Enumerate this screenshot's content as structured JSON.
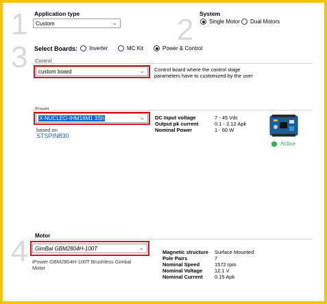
{
  "step1": {
    "number": "1",
    "title": "Application type",
    "select_value": "Custom"
  },
  "step2": {
    "number": "2",
    "title": "System",
    "options": [
      {
        "label": "Single Motor",
        "selected": true
      },
      {
        "label": "Dual Motors",
        "selected": false
      }
    ]
  },
  "step3": {
    "number": "3",
    "title": "Select Boards:",
    "options": [
      {
        "label": "Inverter",
        "selected": false
      },
      {
        "label": "MC Kit",
        "selected": false
      },
      {
        "label": "Power & Control",
        "selected": true
      }
    ]
  },
  "control": {
    "group_label": "Control",
    "select_value": "custom board",
    "description": "Control board where the control stage parameters have to customized by the user"
  },
  "power": {
    "group_label": "Power",
    "select_value": "X-NUCLEO-IHM16M1 3Sh",
    "based_on_label": "based on",
    "based_on_link": "STSPIN830",
    "specs": [
      {
        "key": "DC Input voltage",
        "value": "7 - 45 Vdc"
      },
      {
        "key": "Output pk current",
        "value": "0.1 - 2.12 Apk"
      },
      {
        "key": "Nominal Power",
        "value": "1 - 60 W"
      }
    ],
    "status": "Active",
    "status_color": "#2db34a"
  },
  "step4": {
    "number": "4",
    "title": "Motor",
    "select_value": "GimBal GBM2804H-100T",
    "description": "iPower GBM2804H-100T Brushless Gimbal Motor",
    "specs": [
      {
        "key": "Magnetic structure",
        "value": "Surface Mounted"
      },
      {
        "key": "Pole Pairs",
        "value": "7"
      },
      {
        "key": "Nominal Speed",
        "value": "1572 rpm"
      },
      {
        "key": "Nominal Voltage",
        "value": "12.1 V"
      },
      {
        "key": "Nominal Current",
        "value": "0.15 Apk"
      }
    ]
  },
  "colors": {
    "frame": "#f5c400",
    "highlight_border": "#d0141c",
    "link": "#1e5fbf"
  }
}
